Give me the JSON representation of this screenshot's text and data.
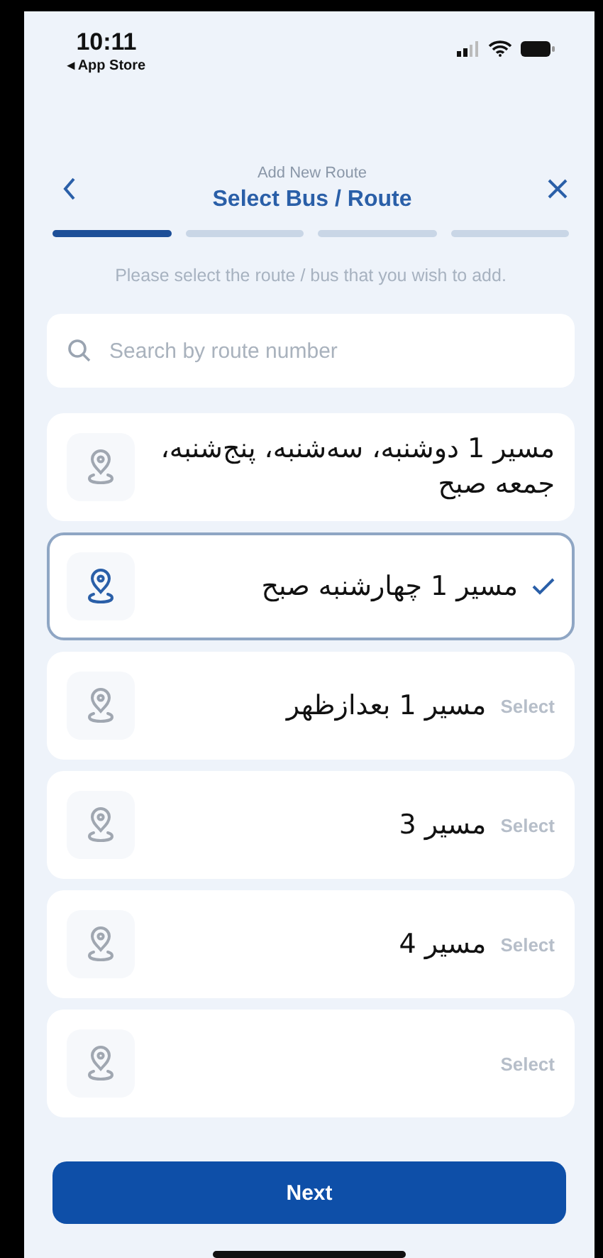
{
  "status_bar": {
    "time": "10:11",
    "back_label": "◂ App Store"
  },
  "header": {
    "subtitle": "Add New Route",
    "title": "Select Bus / Route"
  },
  "steps": [
    {
      "selected": true
    },
    {
      "selected": false
    },
    {
      "selected": false
    },
    {
      "selected": false
    }
  ],
  "instruction": "Please select the route / bus that you wish to add.",
  "search": {
    "placeholder": "Search by route number"
  },
  "routes": [
    {
      "title": "مسیر 1 دوشنبه، سه‌شنبه، پنج‌شنبه، جمعه صبح",
      "selected": false
    },
    {
      "title": "مسیر 1 چهارشنبه صبح",
      "selected": true
    },
    {
      "title": "مسیر 1 بعدازظهر",
      "selected": false,
      "action": "Select"
    },
    {
      "title": "مسیر 3",
      "selected": false,
      "action": "Select"
    },
    {
      "title": "مسیر 4",
      "selected": false,
      "action": "Select"
    },
    {
      "selected": false,
      "action": "Select"
    }
  ],
  "next_button": "Next"
}
